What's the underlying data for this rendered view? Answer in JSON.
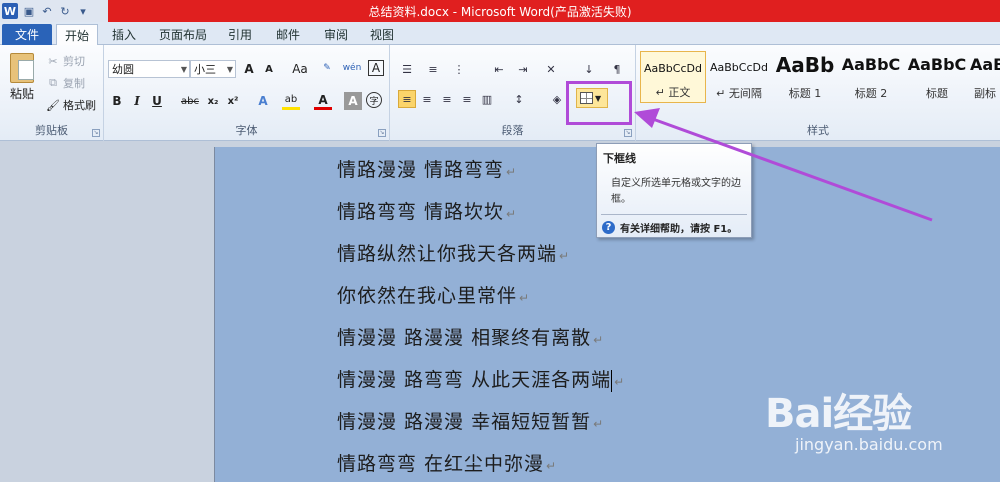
{
  "window": {
    "title": "总结资料.docx - Microsoft Word(产品激活失败)",
    "logo": "W",
    "qat": [
      "save-icon",
      "undo-icon",
      "redo-icon",
      "customize-icon"
    ]
  },
  "tabs": [
    {
      "label": "文件"
    },
    {
      "label": "开始"
    },
    {
      "label": "插入"
    },
    {
      "label": "页面布局"
    },
    {
      "label": "引用"
    },
    {
      "label": "邮件"
    },
    {
      "label": "审阅"
    },
    {
      "label": "视图"
    }
  ],
  "clipboard": {
    "paste_label": "粘贴",
    "cut_label": "剪切",
    "copy_label": "复制",
    "format_painter_label": "格式刷",
    "group_label": "剪贴板"
  },
  "font": {
    "family": "幼圆",
    "size": "小三",
    "grow": "A",
    "shrink": "A",
    "change_case": "Aa",
    "phonetic": "wén",
    "border_char": "A",
    "bold": "B",
    "italic": "I",
    "underline": "U",
    "strike": "abc",
    "subscript": "x₂",
    "superscript": "x²",
    "effects": "A",
    "highlight": "ab",
    "color": "A",
    "shade": "A",
    "enclose": "字",
    "group_label": "字体"
  },
  "paragraph": {
    "group_label": "段落"
  },
  "styles": {
    "group_label": "样式",
    "items": [
      {
        "sample": "AaBbCcDd",
        "name": "↵ 正文"
      },
      {
        "sample": "AaBbCcDd",
        "name": "↵ 无间隔"
      },
      {
        "sample": "AaBb",
        "name": "标题 1"
      },
      {
        "sample": "AaBbC",
        "name": "标题 2"
      },
      {
        "sample": "AaBbC",
        "name": "标题"
      },
      {
        "sample": "AaBl",
        "name": "副标"
      }
    ]
  },
  "tooltip": {
    "title": "下框线",
    "description": "自定义所选单元格或文字的边框。",
    "help": "有关详细帮助，请按 F1。"
  },
  "document": {
    "lines": [
      "情路漫漫  情路弯弯",
      "情路弯弯  情路坎坎",
      "情路纵然让你我天各两端",
      "你依然在我心里常伴",
      "情漫漫  路漫漫  相聚终有离散",
      "情漫漫  路弯弯  从此天涯各两端",
      "情漫漫  路漫漫  幸福短短暂暂",
      "情路弯弯  在红尘中弥漫"
    ],
    "paragraph_mark": "↵"
  },
  "watermark": {
    "logo": "Bai经验",
    "url": "jingyan.baidu.com"
  },
  "colors": {
    "title_bar": "#e01f1f",
    "file_tab": "#2a63b8",
    "page": "#93b0d6",
    "annotation": "#b04bd8"
  }
}
